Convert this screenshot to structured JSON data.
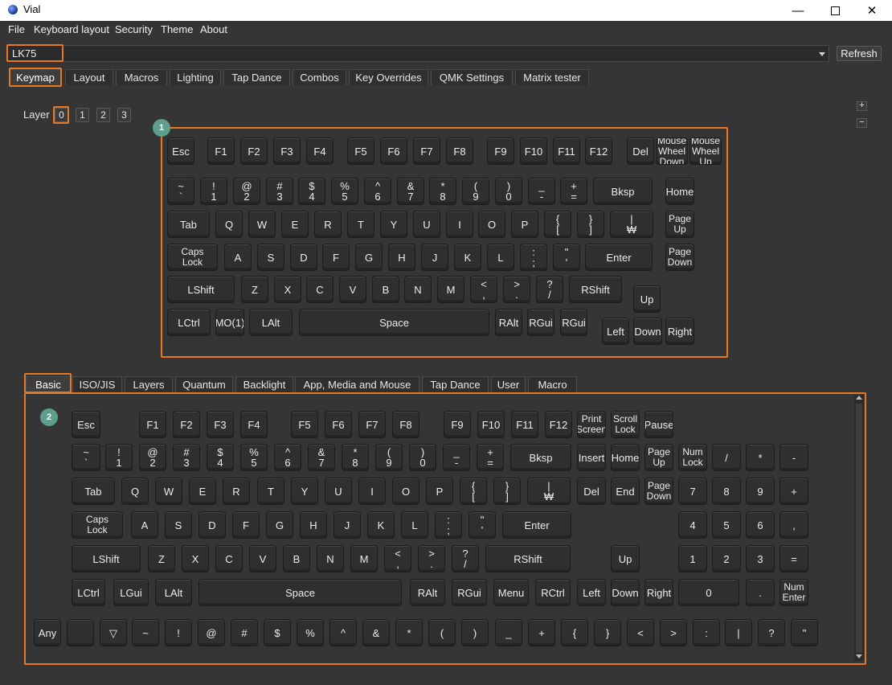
{
  "window": {
    "title": "Vial"
  },
  "menu": [
    "File",
    "Keyboard layout",
    "Security",
    "Theme",
    "About"
  ],
  "keyboard_select": {
    "value": "LK75"
  },
  "refresh_label": "Refresh",
  "main_tabs": [
    "Keymap",
    "Layout",
    "Macros",
    "Lighting",
    "Tap Dance",
    "Combos",
    "Key Overrides",
    "QMK Settings",
    "Matrix tester"
  ],
  "layer": {
    "label": "Layer",
    "buttons": [
      "0",
      "1",
      "2",
      "3"
    ],
    "selected": "0"
  },
  "zoom": {
    "plus": "+",
    "minus": "−"
  },
  "badges": {
    "keyboard": "1",
    "keycodes": "2"
  },
  "keyboard_keys": [
    "Esc",
    "F1",
    "F2",
    "F3",
    "F4",
    "F5",
    "F6",
    "F7",
    "F8",
    "F9",
    "F10",
    "F11",
    "F12",
    "Del",
    "Mouse\nWheel\nDown",
    "Mouse\nWheel\nUp",
    "~\n`",
    "!\n1",
    "@\n2",
    "#\n3",
    "$\n4",
    "%\n5",
    "^\n6",
    "&\n7",
    "*\n8",
    "(\n9",
    ")\n0",
    "_\n-",
    "+\n=",
    "Bksp",
    "Home",
    "Tab",
    "Q",
    "W",
    "E",
    "R",
    "T",
    "Y",
    "U",
    "I",
    "O",
    "P",
    "{\n[",
    "}\n]",
    "|\n₩",
    "Page\nUp",
    "Caps\nLock",
    "A",
    "S",
    "D",
    "F",
    "G",
    "H",
    "J",
    "K",
    "L",
    ":\n;",
    "\"\n'",
    "Enter",
    "Page\nDown",
    "LShift",
    "Z",
    "X",
    "C",
    "V",
    "B",
    "N",
    "M",
    "<\n,",
    ">\n.",
    "?\n/",
    "RShift",
    "Up",
    "LCtrl",
    "MO(1)",
    "LAlt",
    "Space",
    "RAlt",
    "RGui",
    "RGui",
    "Left",
    "Down",
    "Right"
  ],
  "keycode_tabs": [
    "Basic",
    "ISO/JIS",
    "Layers",
    "Quantum",
    "Backlight",
    "App, Media and Mouse",
    "Tap Dance",
    "User",
    "Macro"
  ],
  "keycode_keys": [
    "Esc",
    "F1",
    "F2",
    "F3",
    "F4",
    "F5",
    "F6",
    "F7",
    "F8",
    "F9",
    "F10",
    "F11",
    "F12",
    "Print\nScreen",
    "Scroll\nLock",
    "Pause",
    "~\n`",
    "!\n1",
    "@\n2",
    "#\n3",
    "$\n4",
    "%\n5",
    "^\n6",
    "&\n7",
    "*\n8",
    "(\n9",
    ")\n0",
    "_\n-",
    "+\n=",
    "Bksp",
    "Insert",
    "Home",
    "Page\nUp",
    "Num\nLock",
    "/",
    "*",
    "-",
    "Tab",
    "Q",
    "W",
    "E",
    "R",
    "T",
    "Y",
    "U",
    "I",
    "O",
    "P",
    "{\n[",
    "}\n]",
    "|\n₩",
    "Del",
    "End",
    "Page\nDown",
    "7",
    "8",
    "9",
    "+",
    "Caps\nLock",
    "A",
    "S",
    "D",
    "F",
    "G",
    "H",
    "J",
    "K",
    "L",
    ":\n;",
    "\"\n'",
    "Enter",
    "4",
    "5",
    "6",
    ",",
    "LShift",
    "Z",
    "X",
    "C",
    "V",
    "B",
    "N",
    "M",
    "<\n,",
    ">\n.",
    "?\n/",
    "RShift",
    "Up",
    "1",
    "2",
    "3",
    "=",
    "LCtrl",
    "LGui",
    "LAlt",
    "Space",
    "RAlt",
    "RGui",
    "Menu",
    "RCtrl",
    "Left",
    "Down",
    "Right",
    "0",
    ".",
    "Num\nEnter",
    "Any",
    "",
    "▽",
    "~",
    "!",
    "@",
    "#",
    "$",
    "%",
    "^",
    "&",
    "*",
    "(",
    ")",
    "_",
    "+",
    "{",
    "}",
    "<",
    ">",
    ":",
    "|",
    "?",
    "\""
  ],
  "colors": {
    "highlight": "#e87722",
    "badge": "#5f9e8c",
    "background": "#353535"
  }
}
